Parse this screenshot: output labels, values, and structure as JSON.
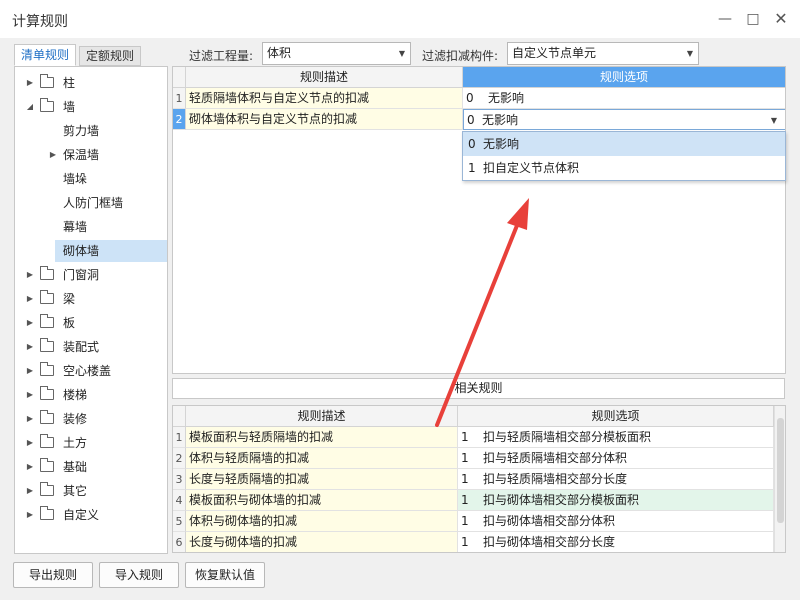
{
  "window": {
    "title": "计算规则",
    "minimize_icon": "minimize-icon",
    "maximize_icon": "maximize-icon",
    "close_icon": "close-icon"
  },
  "tabs": [
    {
      "label": "清单规则",
      "active": true
    },
    {
      "label": "定额规则",
      "active": false
    }
  ],
  "filters": {
    "quantity_label": "过滤工程量:",
    "quantity_value": "体积",
    "component_label": "过滤扣减构件:",
    "component_value": "自定义节点单元"
  },
  "tree": [
    {
      "label": "柱",
      "expanded": false,
      "folder": true
    },
    {
      "label": "墙",
      "expanded": true,
      "folder": true
    },
    {
      "label": "剪力墙"
    },
    {
      "label": "保温墙",
      "collapsed_child": true
    },
    {
      "label": "墙垛"
    },
    {
      "label": "人防门框墙"
    },
    {
      "label": "幕墙"
    },
    {
      "label": "砌体墙",
      "selected": true
    },
    {
      "label": "门窗洞",
      "folder": true
    },
    {
      "label": "梁",
      "folder": true
    },
    {
      "label": "板",
      "folder": true
    },
    {
      "label": "装配式",
      "folder": true
    },
    {
      "label": "空心楼盖",
      "folder": true
    },
    {
      "label": "楼梯",
      "folder": true
    },
    {
      "label": "装修",
      "folder": true
    },
    {
      "label": "土方",
      "folder": true
    },
    {
      "label": "基础",
      "folder": true
    },
    {
      "label": "其它",
      "folder": true
    },
    {
      "label": "自定义",
      "folder": true
    }
  ],
  "top_grid": {
    "headers": [
      "规则描述",
      "规则选项"
    ],
    "rows": [
      {
        "no": "1",
        "desc": "轻质隔墙体积与自定义节点的扣减",
        "opt_num": "0",
        "opt_text": "无影响"
      },
      {
        "no": "2",
        "desc": "砌体墙体积与自定义节点的扣减",
        "opt_num": "0",
        "opt_text": "无影响"
      }
    ]
  },
  "dropdown": {
    "options": [
      {
        "num": "0",
        "text": "无影响"
      },
      {
        "num": "1",
        "text": "扣自定义节点体积"
      }
    ]
  },
  "related_caption": "相关规则",
  "bottom_grid": {
    "headers": [
      "规则描述",
      "规则选项"
    ],
    "rows": [
      {
        "no": "1",
        "desc": "模板面积与轻质隔墙的扣减",
        "opt_num": "1",
        "opt_text": "扣与轻质隔墙相交部分模板面积"
      },
      {
        "no": "2",
        "desc": "体积与轻质隔墙的扣减",
        "opt_num": "1",
        "opt_text": "扣与轻质隔墙相交部分体积"
      },
      {
        "no": "3",
        "desc": "长度与轻质隔墙的扣减",
        "opt_num": "1",
        "opt_text": "扣与轻质隔墙相交部分长度"
      },
      {
        "no": "4",
        "desc": "模板面积与砌体墙的扣减",
        "opt_num": "1",
        "opt_text": "扣与砌体墙相交部分模板面积"
      },
      {
        "no": "5",
        "desc": "体积与砌体墙的扣减",
        "opt_num": "1",
        "opt_text": "扣与砌体墙相交部分体积"
      },
      {
        "no": "6",
        "desc": "长度与砌体墙的扣减",
        "opt_num": "1",
        "opt_text": "扣与砌体墙相交部分长度"
      }
    ]
  },
  "buttons": {
    "export": "导出规则",
    "import": "导入规则",
    "restore": "恢复默认值"
  },
  "colors": {
    "accent": "#5aa4ee",
    "selected": "#cde3f7",
    "desc_bg": "#fffde5",
    "highlight_row": "#e3f5ea",
    "annotation_arrow": "#e8403a"
  }
}
